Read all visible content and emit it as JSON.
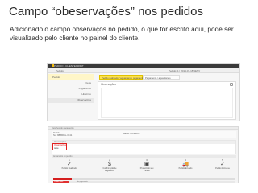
{
  "slide": {
    "title": "Campo “obeservações” nos pedidos",
    "description_lines": [
      "Adicionado o campo observaçõs no pedido, o que for escrito aqui, pode ser",
      "visualizado pelo cliente no painel do cliente."
    ]
  },
  "shot1": {
    "topbar_text": "PEDIDO - CLIENTE/BRINT",
    "subbar_text": "Pedidos",
    "sidebar": {
      "header": "Pedido",
      "items": [
        "Itens",
        "Pagamento",
        "Histórico",
        "Observações"
      ],
      "selected": "Observações"
    },
    "tabs": [
      "Pedido realizado / aguardando pagamento",
      "Pagamento / aguardando"
    ],
    "subbar_right": "Pedido: 1 | 2014-03-18 9ENV",
    "panel_label": "Observações"
  },
  "shot2": {
    "header": "Detalhes do pagamento",
    "info_left": [
      "Pedido",
      "No: 88-BR m-3141"
    ],
    "info_right": "Status: Pendente",
    "obs_header": "Observações",
    "obs_highlight": [
      "Observações",
      "teste"
    ],
    "steps_header": "Andamento do pedido",
    "steps": [
      {
        "n": "1",
        "icon": "✓",
        "label": "Pedido Realizado"
      },
      {
        "n": "2",
        "icon": "$",
        "label": "Confirmação de Pagamento"
      },
      {
        "n": "3",
        "icon": "▣",
        "label": "Produzindo seu Pedido"
      },
      {
        "n": "4",
        "icon": "🚚",
        "label": "Pedido Enviado"
      },
      {
        "n": "5",
        "icon": "✓",
        "label": "Pedido Entregue"
      }
    ],
    "progress": 0.1,
    "footer_left": "Pedido Falta",
    "footer_right": "do pagamento"
  },
  "colors": {
    "accent_yellow": "#ffe34d",
    "highlight_red": "#e02020",
    "progress_red": "#d51f1f"
  }
}
